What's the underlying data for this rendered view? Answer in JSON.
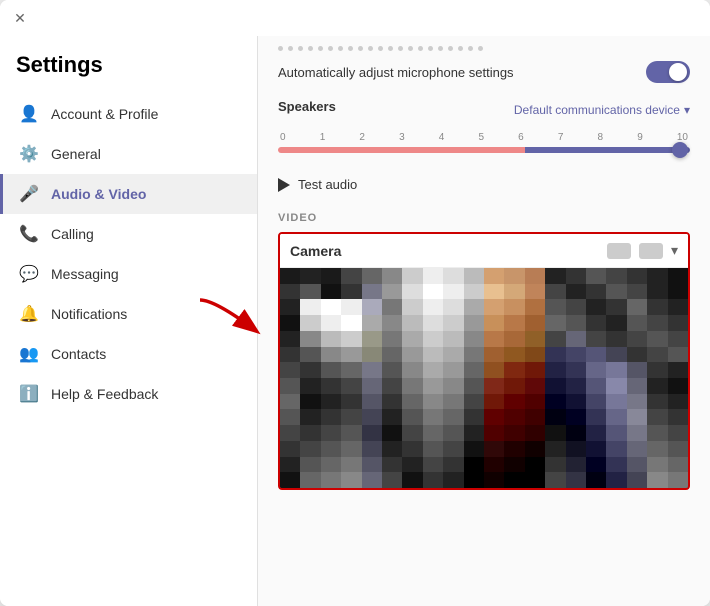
{
  "window": {
    "title": "Settings"
  },
  "titleBar": {
    "closeIcon": "✕"
  },
  "sidebar": {
    "title": "Settings",
    "items": [
      {
        "id": "account-profile",
        "label": "Account & Profile",
        "icon": "👤"
      },
      {
        "id": "general",
        "label": "General",
        "icon": "⚙️"
      },
      {
        "id": "audio-video",
        "label": "Audio & Video",
        "icon": "🎤",
        "active": true
      },
      {
        "id": "calling",
        "label": "Calling",
        "icon": "📞"
      },
      {
        "id": "messaging",
        "label": "Messaging",
        "icon": "💬"
      },
      {
        "id": "notifications",
        "label": "Notifications",
        "icon": "🔔"
      },
      {
        "id": "contacts",
        "label": "Contacts",
        "icon": "👥"
      },
      {
        "id": "help-feedback",
        "label": "Help & Feedback",
        "icon": "ℹ️"
      }
    ]
  },
  "main": {
    "autoAdjustLabel": "Automatically adjust microphone settings",
    "speakersLabel": "Speakers",
    "deviceSelector": "Default communications device",
    "sliderMarks": [
      "0",
      "1",
      "2",
      "3",
      "4",
      "5",
      "6",
      "7",
      "8",
      "9",
      "10"
    ],
    "testAudioLabel": "Test audio",
    "videoSectionLabel": "VIDEO",
    "cameraLabel": "Camera"
  },
  "pixels": [
    "#1a1a1a",
    "#222",
    "#1a1a1a",
    "#444",
    "#666",
    "#888",
    "#ccc",
    "#eee",
    "#ddd",
    "#bbb",
    "#d4a070",
    "#c8956a",
    "#b87d55",
    "#222",
    "#333",
    "#555",
    "#444",
    "#333",
    "#222",
    "#111",
    "#333",
    "#555",
    "#111",
    "#333",
    "#778",
    "#999",
    "#ddd",
    "#fff",
    "#eee",
    "#ccc",
    "#e8c090",
    "#d4a878",
    "#c0845a",
    "#444",
    "#222",
    "#333",
    "#555",
    "#444",
    "#222",
    "#111",
    "#222",
    "#eee",
    "#fff",
    "#eee",
    "#aab",
    "#777",
    "#ccc",
    "#eee",
    "#ddd",
    "#aaa",
    "#d4a070",
    "#c89060",
    "#b07040",
    "#555",
    "#444",
    "#222",
    "#333",
    "#666",
    "#333",
    "#222",
    "#111",
    "#ccc",
    "#eee",
    "#fff",
    "#aaa",
    "#888",
    "#bbb",
    "#ddd",
    "#ccc",
    "#999",
    "#c8905a",
    "#b87848",
    "#a06030",
    "#666",
    "#555",
    "#333",
    "#222",
    "#555",
    "#444",
    "#333",
    "#222",
    "#888",
    "#bbb",
    "#ccc",
    "#998",
    "#777",
    "#aaa",
    "#ccc",
    "#bbb",
    "#888",
    "#b87848",
    "#a86838",
    "#906028",
    "#444",
    "#667",
    "#444",
    "#333",
    "#444",
    "#555",
    "#444",
    "#333",
    "#555",
    "#888",
    "#999",
    "#887",
    "#666",
    "#999",
    "#bbb",
    "#aaa",
    "#777",
    "#a06030",
    "#905820",
    "#804818",
    "#335",
    "#446",
    "#557",
    "#445",
    "#333",
    "#444",
    "#555",
    "#444",
    "#333",
    "#555",
    "#666",
    "#778",
    "#555",
    "#888",
    "#aaa",
    "#999",
    "#666",
    "#905020",
    "#802810",
    "#701808",
    "#224",
    "#335",
    "#668",
    "#779",
    "#556",
    "#333",
    "#222",
    "#555",
    "#222",
    "#333",
    "#444",
    "#667",
    "#444",
    "#777",
    "#999",
    "#888",
    "#555",
    "#802818",
    "#701808",
    "#600808",
    "#113",
    "#224",
    "#557",
    "#88a",
    "#667",
    "#222",
    "#111",
    "#666",
    "#111",
    "#222",
    "#333",
    "#556",
    "#333",
    "#666",
    "#888",
    "#777",
    "#444",
    "#701808",
    "#600000",
    "#500000",
    "#002",
    "#113",
    "#446",
    "#779",
    "#778",
    "#333",
    "#222",
    "#555",
    "#222",
    "#333",
    "#444",
    "#445",
    "#222",
    "#555",
    "#777",
    "#666",
    "#333",
    "#600000",
    "#500000",
    "#400000",
    "#001",
    "#002",
    "#335",
    "#668",
    "#889",
    "#444",
    "#333",
    "#444",
    "#333",
    "#444",
    "#555",
    "#334",
    "#111",
    "#444",
    "#666",
    "#555",
    "#222",
    "#500000",
    "#400000",
    "#300000",
    "#111",
    "#001",
    "#224",
    "#557",
    "#778",
    "#555",
    "#444",
    "#333",
    "#444",
    "#555",
    "#666",
    "#445",
    "#222",
    "#333",
    "#555",
    "#444",
    "#111",
    "#300808",
    "#200000",
    "#100000",
    "#222",
    "#112",
    "#113",
    "#446",
    "#667",
    "#666",
    "#555",
    "#222",
    "#555",
    "#666",
    "#777",
    "#556",
    "#333",
    "#222",
    "#444",
    "#333",
    "#000",
    "#200000",
    "#100000",
    "#000000",
    "#333",
    "#223",
    "#002",
    "#335",
    "#556",
    "#777",
    "#666",
    "#111",
    "#666",
    "#777",
    "#888",
    "#667",
    "#444",
    "#111",
    "#333",
    "#222",
    "#000",
    "#100000",
    "#000000",
    "#000000",
    "#444",
    "#334",
    "#001",
    "#224",
    "#445",
    "#888",
    "#777"
  ]
}
